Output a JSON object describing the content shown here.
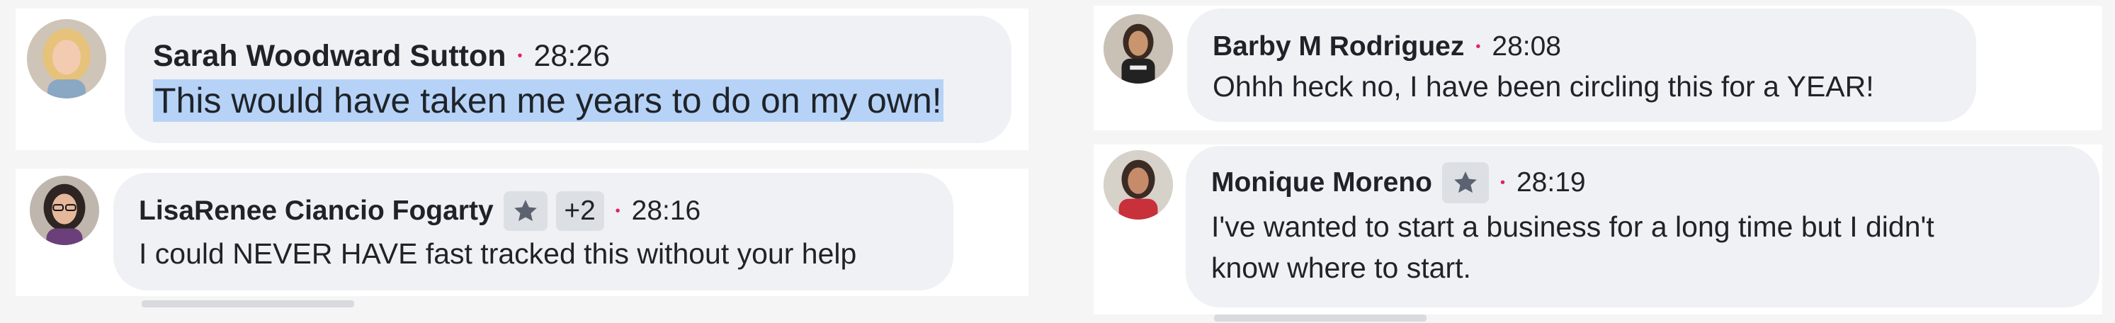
{
  "comments": [
    {
      "id": "sarah",
      "author": "Sarah Woodward Sutton",
      "time": "28:26",
      "text": "This would have taken me years to do on my own!",
      "selected": true,
      "avatar_icon": "profile-photo-blonde-woman"
    },
    {
      "id": "lisarenee",
      "author": "LisaRenee Ciancio Fogarty",
      "badge_icon": "star-badge-icon",
      "extra_badges": "+2",
      "time": "28:16",
      "text": "I could NEVER HAVE fast tracked this without your help",
      "avatar_icon": "profile-photo-woman-glasses"
    },
    {
      "id": "barby",
      "author": "Barby M Rodriguez",
      "time": "28:08",
      "text": "Ohhh heck no, I have been circling this for a YEAR!",
      "avatar_icon": "profile-photo-woman-teacher-shirt"
    },
    {
      "id": "monique",
      "author": "Monique Moreno",
      "badge_icon": "star-badge-icon",
      "time": "28:19",
      "text_lines": [
        "I've wanted to start a business for a long time but I didn't",
        "know where to start."
      ],
      "avatar_icon": "profile-photo-woman-red-top"
    }
  ],
  "colors": {
    "bubble": "#eff1f4",
    "separator_dot": "#e0245e",
    "selection": "#b6d3f7",
    "badge_bg": "#dcdfe4",
    "text": "#1f2329"
  }
}
